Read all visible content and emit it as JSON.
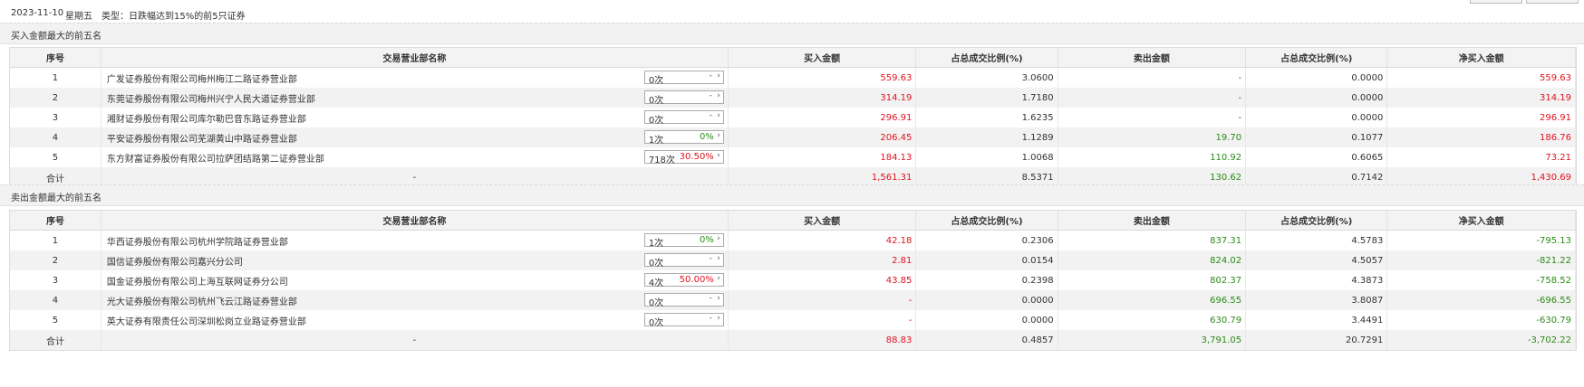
{
  "header": {
    "date": "2023-11-10",
    "weekday": "星期五",
    "type_label": "类型：日跌幅达到15%的前5只证券"
  },
  "columns": [
    "序号",
    "交易营业部名称",
    "买入金额",
    "占总成交比例(%)",
    "卖出金额",
    "占总成交比例(%)",
    "净买入金额"
  ],
  "buy_section": {
    "title": "买入金额最大的前五名",
    "rows": [
      {
        "no": "1",
        "name": "广发证券股份有限公司梅州梅江二路证券营业部",
        "count": "0次",
        "pct": "",
        "buy": "559.63",
        "buy_ratio": "3.0600",
        "sell": "-",
        "sell_ratio": "0.0000",
        "net": "559.63"
      },
      {
        "no": "2",
        "name": "东莞证券股份有限公司梅州兴宁人民大道证券营业部",
        "count": "0次",
        "pct": "",
        "buy": "314.19",
        "buy_ratio": "1.7180",
        "sell": "-",
        "sell_ratio": "0.0000",
        "net": "314.19"
      },
      {
        "no": "3",
        "name": "湘财证券股份有限公司库尔勒巴音东路证券营业部",
        "count": "0次",
        "pct": "",
        "buy": "296.91",
        "buy_ratio": "1.6235",
        "sell": "-",
        "sell_ratio": "0.0000",
        "net": "296.91"
      },
      {
        "no": "4",
        "name": "平安证券股份有限公司芜湖黄山中路证券营业部",
        "count": "1次",
        "pct": "0%",
        "buy": "206.45",
        "buy_ratio": "1.1289",
        "sell": "19.70",
        "sell_ratio": "0.1077",
        "net": "186.76"
      },
      {
        "no": "5",
        "name": "东方财富证券股份有限公司拉萨团结路第二证券营业部",
        "count": "718次",
        "pct": "30.50%",
        "buy": "184.13",
        "buy_ratio": "1.0068",
        "sell": "110.92",
        "sell_ratio": "0.6065",
        "net": "73.21"
      }
    ],
    "total": {
      "label": "合计",
      "name": "-",
      "buy": "1,561.31",
      "buy_ratio": "8.5371",
      "sell": "130.62",
      "sell_ratio": "0.7142",
      "net": "1,430.69"
    }
  },
  "sell_section": {
    "title": "卖出金额最大的前五名",
    "rows": [
      {
        "no": "1",
        "name": "华西证券股份有限公司杭州学院路证券营业部",
        "count": "1次",
        "pct": "0%",
        "buy": "42.18",
        "buy_ratio": "0.2306",
        "sell": "837.31",
        "sell_ratio": "4.5783",
        "net": "-795.13"
      },
      {
        "no": "2",
        "name": "国信证券股份有限公司嘉兴分公司",
        "count": "0次",
        "pct": "",
        "buy": "2.81",
        "buy_ratio": "0.0154",
        "sell": "824.02",
        "sell_ratio": "4.5057",
        "net": "-821.22"
      },
      {
        "no": "3",
        "name": "国金证券股份有限公司上海互联网证券分公司",
        "count": "4次",
        "pct": "50.00%",
        "buy": "43.85",
        "buy_ratio": "0.2398",
        "sell": "802.37",
        "sell_ratio": "4.3873",
        "net": "-758.52"
      },
      {
        "no": "4",
        "name": "光大证券股份有限公司杭州飞云江路证券营业部",
        "count": "0次",
        "pct": "",
        "buy": "-",
        "buy_ratio": "0.0000",
        "sell": "696.55",
        "sell_ratio": "3.8087",
        "net": "-696.55"
      },
      {
        "no": "5",
        "name": "英大证券有限责任公司深圳松岗立业路证券营业部",
        "count": "0次",
        "pct": "",
        "buy": "-",
        "buy_ratio": "0.0000",
        "sell": "630.79",
        "sell_ratio": "3.4491",
        "net": "-630.79"
      }
    ],
    "total": {
      "label": "合计",
      "name": "-",
      "buy": "88.83",
      "buy_ratio": "0.4857",
      "sell": "3,791.05",
      "sell_ratio": "20.7291",
      "net": "-3,702.22"
    }
  },
  "colors": {
    "buy": "#e0121f",
    "sell": "#2c8a17",
    "pct_up": "#e0121f",
    "pct_flat": "#2c8a17"
  }
}
